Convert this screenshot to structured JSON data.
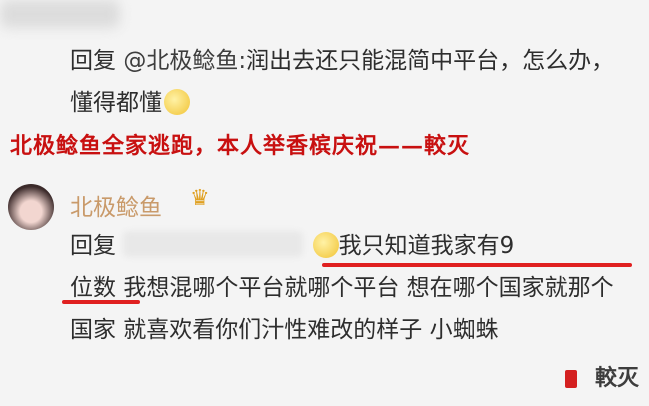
{
  "reply1": {
    "prefix": "回复 ",
    "mention": "@北极鲶鱼:",
    "text": "润出去还只能混简中平台，怎么办，懂得都懂",
    "emoji_icon": "smiling-face-emoji-icon"
  },
  "caption": "北极鲶鱼全家逃跑，本人举香槟庆祝——較灭",
  "comment": {
    "username": "北极鲶鱼",
    "reply_prefix": "回复",
    "text_line1": "我只知道我家有9",
    "text_rest_a": "位数",
    "text_rest_b": "我想混哪个平台就哪个平台 想在哪个国家就那个国家 就喜欢看你们汁性难改的样子 小蜘蛛"
  },
  "watermark": "較灭",
  "colors": {
    "caption": "#c81010",
    "username": "#c99a6a",
    "underline": "#e02020"
  }
}
